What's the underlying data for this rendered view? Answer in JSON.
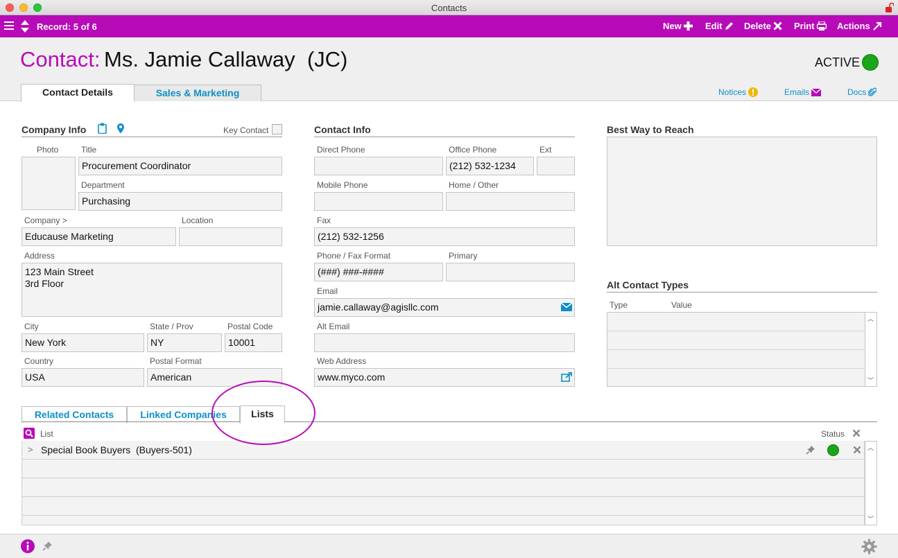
{
  "window": {
    "title": "Contacts"
  },
  "toolbar": {
    "record_label": "Record: 5 of 6",
    "new_label": "New",
    "edit_label": "Edit",
    "delete_label": "Delete",
    "print_label": "Print",
    "actions_label": "Actions"
  },
  "header": {
    "contact_label": "Contact:",
    "contact_name": "Ms. Jamie Callaway  (JC)",
    "status": "ACTIVE",
    "status_color": "#1aa51a",
    "tabs": [
      {
        "label": "Contact Details",
        "active": true
      },
      {
        "label": "Sales & Marketing",
        "active": false
      }
    ],
    "links": {
      "notices": "Notices",
      "emails": "Emails",
      "docs": "Docs"
    }
  },
  "company_info": {
    "title": "Company Info",
    "key_contact_label": "Key Contact",
    "photo_label": "Photo",
    "title_label": "Title",
    "title_value": "Procurement Coordinator",
    "department_label": "Department",
    "department_value": "Purchasing",
    "company_label": "Company >",
    "company_value": "Educause Marketing",
    "location_label": "Location",
    "location_value": "",
    "address_label": "Address",
    "address_value": "123 Main Street\n3rd Floor",
    "city_label": "City",
    "city_value": "New York",
    "state_label": "State / Prov",
    "state_value": "NY",
    "postal_label": "Postal Code",
    "postal_value": "10001",
    "country_label": "Country",
    "country_value": "USA",
    "postal_format_label": "Postal Format",
    "postal_format_value": "American"
  },
  "contact_info": {
    "title": "Contact Info",
    "direct_phone_label": "Direct Phone",
    "direct_phone_value": "",
    "office_phone_label": "Office Phone",
    "office_phone_value": "(212) 532-1234",
    "ext_label": "Ext",
    "ext_value": "",
    "mobile_label": "Mobile Phone",
    "mobile_value": "",
    "home_label": "Home / Other",
    "home_value": "",
    "fax_label": "Fax",
    "fax_value": "(212) 532-1256",
    "phone_format_label": "Phone / Fax Format",
    "phone_format_value": "(###) ###-####",
    "primary_label": "Primary",
    "primary_value": "",
    "email_label": "Email",
    "email_value": "jamie.callaway@agisllc.com",
    "alt_email_label": "Alt Email",
    "alt_email_value": "",
    "web_label": "Web Address",
    "web_value": "www.myco.com"
  },
  "best_way": {
    "title": "Best Way to Reach"
  },
  "alt_contact": {
    "title": "Alt Contact Types",
    "col_type": "Type",
    "col_value": "Value"
  },
  "bottom_tabs": [
    {
      "label": "Related Contacts",
      "active": false
    },
    {
      "label": "Linked Companies",
      "active": false
    },
    {
      "label": "Lists",
      "active": true
    }
  ],
  "lists": {
    "col_list": "List",
    "col_status": "Status",
    "rows": [
      {
        "expander": ">",
        "name": "Special Book Buyers  (Buyers-501)",
        "status_color": "#1aa51a"
      }
    ]
  },
  "colors": {
    "brand": "#b80bb8",
    "link": "#0d8fc8"
  }
}
